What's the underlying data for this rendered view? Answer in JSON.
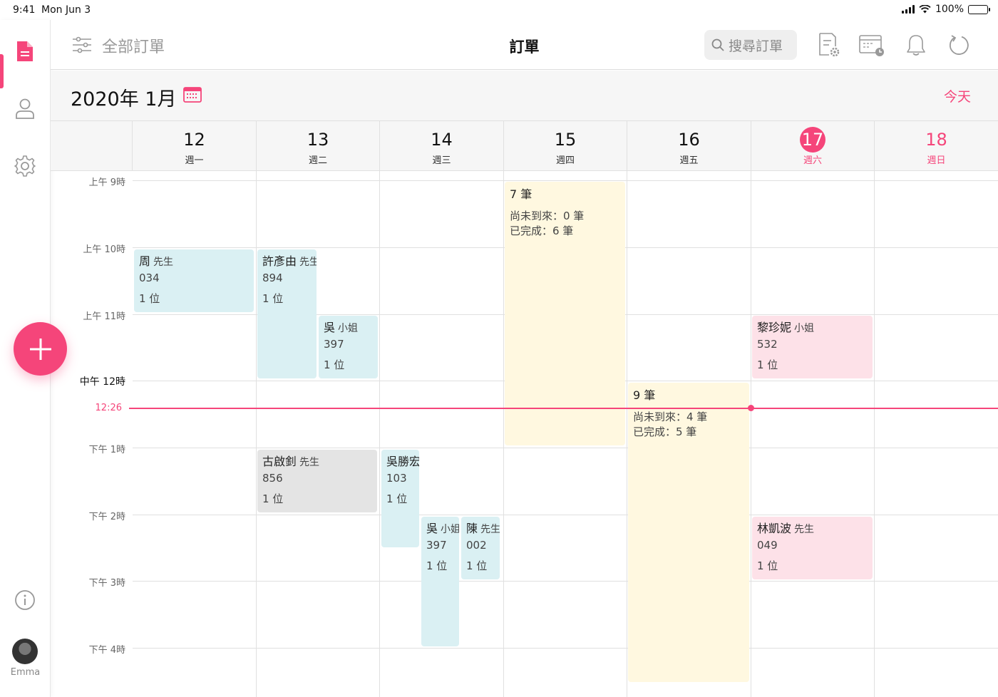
{
  "status_bar": {
    "time": "9:41",
    "date": "Mon Jun 3",
    "battery": "100%"
  },
  "sidebar": {
    "user_name": "Emma"
  },
  "nav": {
    "filter_label": "全部訂單",
    "title": "訂單",
    "search_label": "搜尋訂單"
  },
  "month": {
    "title": "2020年 1月",
    "today": "今天"
  },
  "days": [
    {
      "num": "12",
      "name": "週一"
    },
    {
      "num": "13",
      "name": "週二"
    },
    {
      "num": "14",
      "name": "週三"
    },
    {
      "num": "15",
      "name": "週四"
    },
    {
      "num": "16",
      "name": "週五"
    },
    {
      "num": "17",
      "name": "週六"
    },
    {
      "num": "18",
      "name": "週日"
    }
  ],
  "hours": [
    "上午 9時",
    "上午 10時",
    "上午 11時",
    "中午 12時",
    "下午 1時",
    "下午 2時",
    "下午 3時",
    "下午 4時"
  ],
  "now_label": "12:26",
  "events": [
    {
      "name": "周",
      "title": "先生",
      "code": "034",
      "people": "1 位"
    },
    {
      "name": "許彥由",
      "title": "先生",
      "code": "894",
      "people": "1 位"
    },
    {
      "name": "吳",
      "title": "小姐",
      "code": "397",
      "people": "1 位"
    },
    {
      "name": "古啟釗",
      "title": "先生",
      "code": "856",
      "people": "1 位"
    },
    {
      "name": "吳勝宏",
      "title": "",
      "code": "103",
      "people": "1 位"
    },
    {
      "name": "吳",
      "title": "小姐",
      "code": "397",
      "people": "1 位"
    },
    {
      "name": "陳",
      "title": "先生",
      "code": "002",
      "people": "1 位"
    },
    {
      "name": "黎珍妮",
      "title": "小姐",
      "code": "532",
      "people": "1 位"
    },
    {
      "name": "林凱波",
      "title": "先生",
      "code": "049",
      "people": "1 位"
    }
  ],
  "summaries": [
    {
      "count": "7 筆",
      "pending": "尚未到來：0 筆",
      "done": "已完成：6 筆"
    },
    {
      "count": "9 筆",
      "pending": "尚未到來：4 筆",
      "done": "已完成：5 筆"
    }
  ],
  "colors": {
    "accent": "#f5457a",
    "event_blue": "#daf0f3",
    "event_gray": "#e4e4e4",
    "event_pink": "#fde1e8",
    "summary_yellow": "#fff8e0"
  }
}
